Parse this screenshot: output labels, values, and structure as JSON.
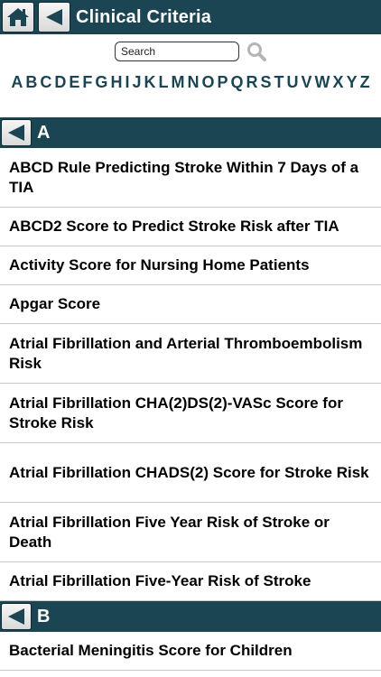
{
  "header": {
    "title": "Clinical Criteria",
    "home_icon": "home-icon",
    "back_icon": "back-arrow-icon"
  },
  "search": {
    "placeholder": "Search"
  },
  "alphabet": [
    "A",
    "B",
    "C",
    "D",
    "E",
    "F",
    "G",
    "H",
    "I",
    "J",
    "K",
    "L",
    "M",
    "N",
    "O",
    "P",
    "Q",
    "R",
    "S",
    "T",
    "U",
    "V",
    "W",
    "X",
    "Y",
    "Z"
  ],
  "sections": [
    {
      "letter": "A",
      "items": [
        "ABCD Rule Predicting Stroke Within 7 Days of a TIA",
        "ABCD2 Score to Predict Stroke Risk after TIA",
        "Activity Score for Nursing Home Patients",
        "Apgar Score",
        "Atrial Fibrillation and Arterial Thromboembolism Risk",
        "Atrial Fibrillation CHA(2)DS(2)-VASc Score for Stroke Risk",
        "Atrial Fibrillation CHADS(2) Score for Stroke Risk",
        "Atrial Fibrillation Five Year Risk of Stroke or Death",
        "Atrial Fibrillation Five-Year Risk of Stroke"
      ]
    },
    {
      "letter": "B",
      "items": [
        "Bacterial Meningitis Score for Children"
      ]
    }
  ],
  "colors": {
    "header_bg": "#1b4552",
    "accent_text": "#1b4552"
  }
}
